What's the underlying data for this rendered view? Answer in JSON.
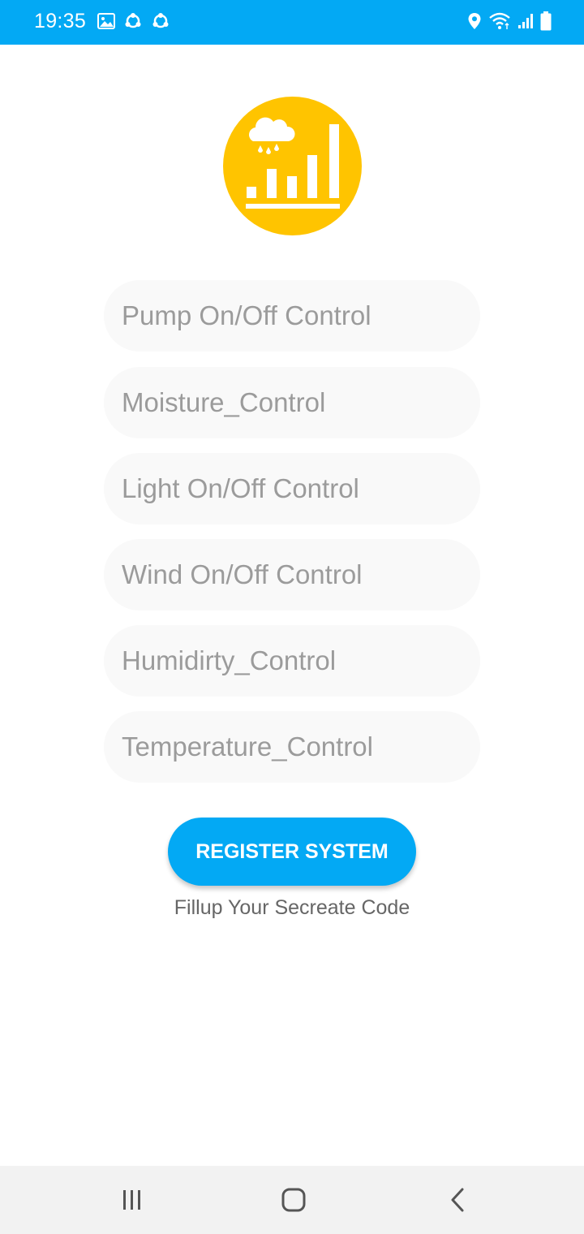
{
  "status_bar": {
    "time": "19:35",
    "background_color": "#03a9f4",
    "left_icons": [
      "image-icon",
      "sync-icon",
      "sync-icon"
    ],
    "right_icons": [
      "location-icon",
      "wifi-icon",
      "signal-icon",
      "battery-icon"
    ]
  },
  "logo": {
    "icon": "weather-chart-logo-icon",
    "background_color": "#ffc400"
  },
  "form": {
    "fields": [
      {
        "placeholder": "Pump On/Off Control",
        "value": ""
      },
      {
        "placeholder": "Moisture_Control",
        "value": ""
      },
      {
        "placeholder": "Light On/Off Control",
        "value": ""
      },
      {
        "placeholder": "Wind On/Off Control",
        "value": ""
      },
      {
        "placeholder": "Humidirty_Control",
        "value": ""
      },
      {
        "placeholder": "Temperature_Control",
        "value": ""
      }
    ],
    "register_label": "REGISTER SYSTEM",
    "hint": "Fillup Your Secreate Code",
    "accent_color": "#03a9f4"
  },
  "nav_bar": {
    "buttons": [
      "recent-apps-icon",
      "home-icon",
      "back-icon"
    ]
  }
}
